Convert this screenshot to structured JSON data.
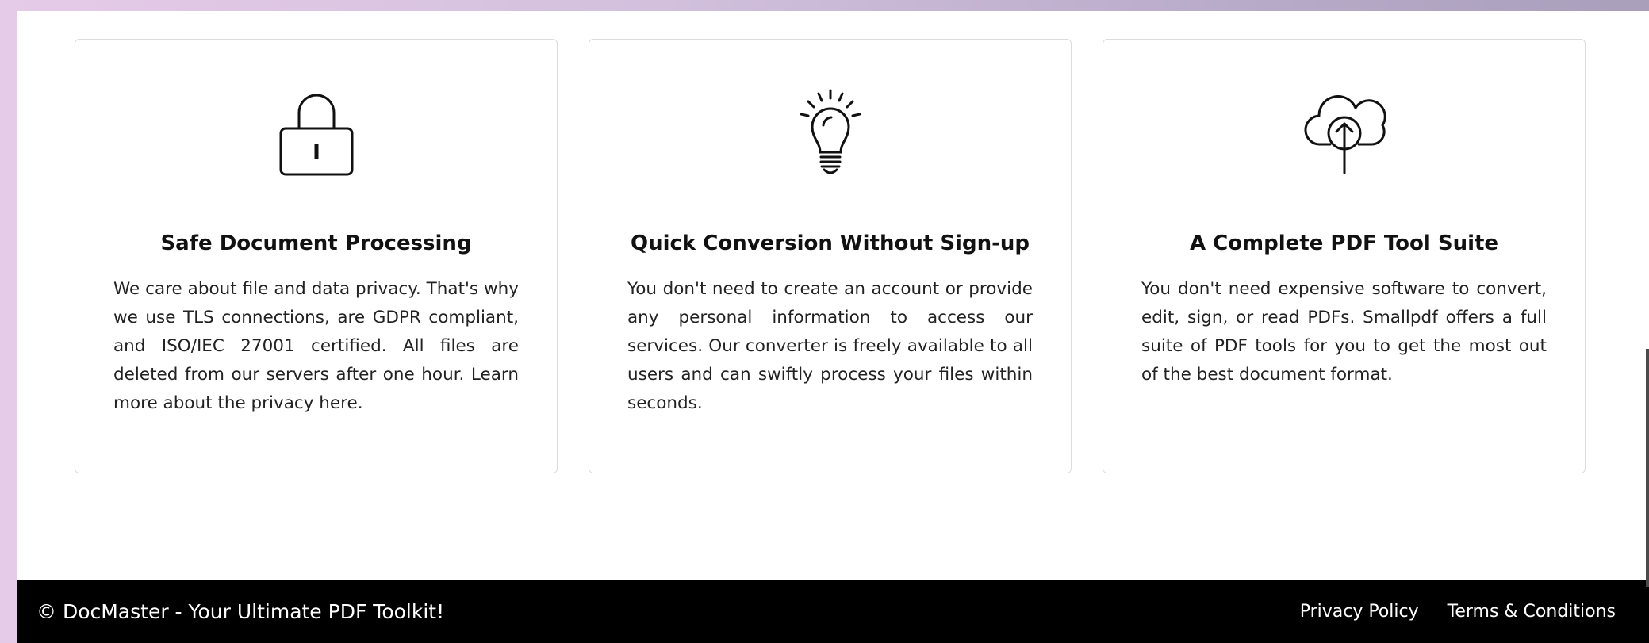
{
  "cards": [
    {
      "icon": "padlock-icon",
      "title": "Safe Document Processing",
      "text": "We care about file and data privacy. That's why we use TLS connections, are GDPR compliant, and ISO/IEC 27001 certified. All files are deleted from our servers after one hour. Learn more about the privacy here."
    },
    {
      "icon": "lightbulb-icon",
      "title": "Quick Conversion Without Sign-up",
      "text": "You don't need to create an account or provide any personal information to access our services. Our converter is freely available to all users and can swiftly process your files within seconds."
    },
    {
      "icon": "cloud-upload-icon",
      "title": "A Complete PDF Tool Suite",
      "text": "You don't need expensive software to convert, edit, sign, or read PDFs. Smallpdf offers a full suite of PDF tools for you to get the most out of the best document format."
    }
  ],
  "footer": {
    "copyright": "© DocMaster - Your Ultimate PDF Toolkit!",
    "links": {
      "privacy": "Privacy Policy",
      "terms": "Terms & Conditions"
    }
  },
  "colors": {
    "footer_bg": "#000000",
    "card_border": "#dcdcdc"
  }
}
